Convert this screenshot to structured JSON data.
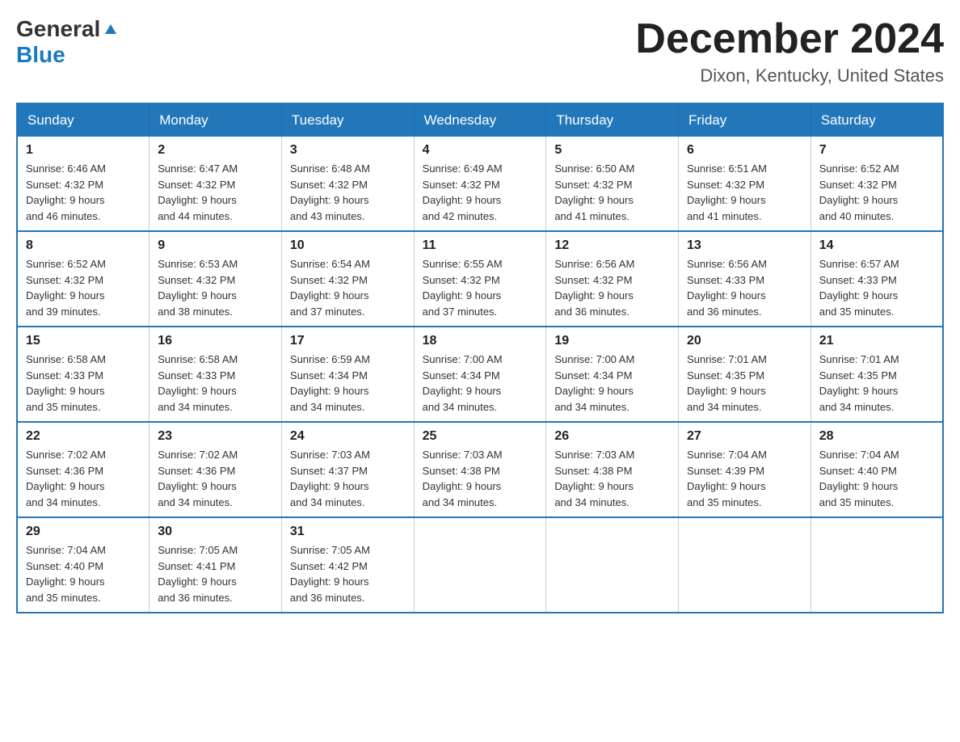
{
  "logo": {
    "general": "General",
    "blue": "Blue"
  },
  "title": {
    "month_year": "December 2024",
    "location": "Dixon, Kentucky, United States"
  },
  "weekdays": [
    "Sunday",
    "Monday",
    "Tuesday",
    "Wednesday",
    "Thursday",
    "Friday",
    "Saturday"
  ],
  "weeks": [
    [
      {
        "day": "1",
        "sunrise": "6:46 AM",
        "sunset": "4:32 PM",
        "daylight": "9 hours and 46 minutes."
      },
      {
        "day": "2",
        "sunrise": "6:47 AM",
        "sunset": "4:32 PM",
        "daylight": "9 hours and 44 minutes."
      },
      {
        "day": "3",
        "sunrise": "6:48 AM",
        "sunset": "4:32 PM",
        "daylight": "9 hours and 43 minutes."
      },
      {
        "day": "4",
        "sunrise": "6:49 AM",
        "sunset": "4:32 PM",
        "daylight": "9 hours and 42 minutes."
      },
      {
        "day": "5",
        "sunrise": "6:50 AM",
        "sunset": "4:32 PM",
        "daylight": "9 hours and 41 minutes."
      },
      {
        "day": "6",
        "sunrise": "6:51 AM",
        "sunset": "4:32 PM",
        "daylight": "9 hours and 41 minutes."
      },
      {
        "day": "7",
        "sunrise": "6:52 AM",
        "sunset": "4:32 PM",
        "daylight": "9 hours and 40 minutes."
      }
    ],
    [
      {
        "day": "8",
        "sunrise": "6:52 AM",
        "sunset": "4:32 PM",
        "daylight": "9 hours and 39 minutes."
      },
      {
        "day": "9",
        "sunrise": "6:53 AM",
        "sunset": "4:32 PM",
        "daylight": "9 hours and 38 minutes."
      },
      {
        "day": "10",
        "sunrise": "6:54 AM",
        "sunset": "4:32 PM",
        "daylight": "9 hours and 37 minutes."
      },
      {
        "day": "11",
        "sunrise": "6:55 AM",
        "sunset": "4:32 PM",
        "daylight": "9 hours and 37 minutes."
      },
      {
        "day": "12",
        "sunrise": "6:56 AM",
        "sunset": "4:32 PM",
        "daylight": "9 hours and 36 minutes."
      },
      {
        "day": "13",
        "sunrise": "6:56 AM",
        "sunset": "4:33 PM",
        "daylight": "9 hours and 36 minutes."
      },
      {
        "day": "14",
        "sunrise": "6:57 AM",
        "sunset": "4:33 PM",
        "daylight": "9 hours and 35 minutes."
      }
    ],
    [
      {
        "day": "15",
        "sunrise": "6:58 AM",
        "sunset": "4:33 PM",
        "daylight": "9 hours and 35 minutes."
      },
      {
        "day": "16",
        "sunrise": "6:58 AM",
        "sunset": "4:33 PM",
        "daylight": "9 hours and 34 minutes."
      },
      {
        "day": "17",
        "sunrise": "6:59 AM",
        "sunset": "4:34 PM",
        "daylight": "9 hours and 34 minutes."
      },
      {
        "day": "18",
        "sunrise": "7:00 AM",
        "sunset": "4:34 PM",
        "daylight": "9 hours and 34 minutes."
      },
      {
        "day": "19",
        "sunrise": "7:00 AM",
        "sunset": "4:34 PM",
        "daylight": "9 hours and 34 minutes."
      },
      {
        "day": "20",
        "sunrise": "7:01 AM",
        "sunset": "4:35 PM",
        "daylight": "9 hours and 34 minutes."
      },
      {
        "day": "21",
        "sunrise": "7:01 AM",
        "sunset": "4:35 PM",
        "daylight": "9 hours and 34 minutes."
      }
    ],
    [
      {
        "day": "22",
        "sunrise": "7:02 AM",
        "sunset": "4:36 PM",
        "daylight": "9 hours and 34 minutes."
      },
      {
        "day": "23",
        "sunrise": "7:02 AM",
        "sunset": "4:36 PM",
        "daylight": "9 hours and 34 minutes."
      },
      {
        "day": "24",
        "sunrise": "7:03 AM",
        "sunset": "4:37 PM",
        "daylight": "9 hours and 34 minutes."
      },
      {
        "day": "25",
        "sunrise": "7:03 AM",
        "sunset": "4:38 PM",
        "daylight": "9 hours and 34 minutes."
      },
      {
        "day": "26",
        "sunrise": "7:03 AM",
        "sunset": "4:38 PM",
        "daylight": "9 hours and 34 minutes."
      },
      {
        "day": "27",
        "sunrise": "7:04 AM",
        "sunset": "4:39 PM",
        "daylight": "9 hours and 35 minutes."
      },
      {
        "day": "28",
        "sunrise": "7:04 AM",
        "sunset": "4:40 PM",
        "daylight": "9 hours and 35 minutes."
      }
    ],
    [
      {
        "day": "29",
        "sunrise": "7:04 AM",
        "sunset": "4:40 PM",
        "daylight": "9 hours and 35 minutes."
      },
      {
        "day": "30",
        "sunrise": "7:05 AM",
        "sunset": "4:41 PM",
        "daylight": "9 hours and 36 minutes."
      },
      {
        "day": "31",
        "sunrise": "7:05 AM",
        "sunset": "4:42 PM",
        "daylight": "9 hours and 36 minutes."
      },
      null,
      null,
      null,
      null
    ]
  ],
  "labels": {
    "sunrise": "Sunrise: ",
    "sunset": "Sunset: ",
    "daylight": "Daylight: "
  }
}
